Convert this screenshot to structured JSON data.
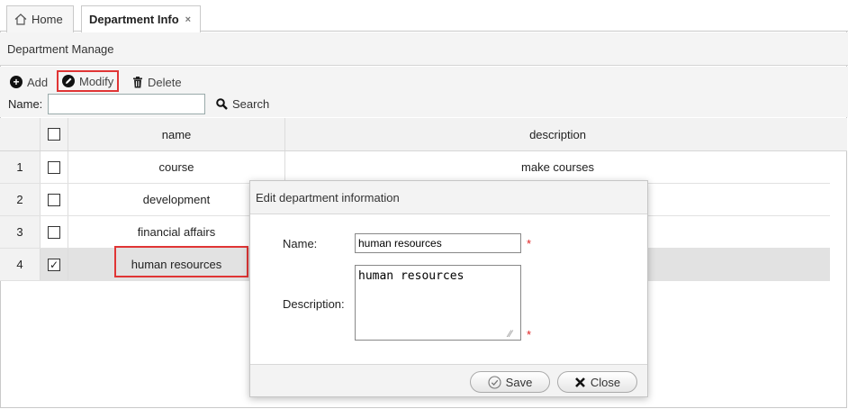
{
  "tabs": [
    {
      "label": "Home",
      "icon": "home-icon"
    },
    {
      "label": "Department Info",
      "close": "×"
    }
  ],
  "panel": {
    "title": "Department Manage"
  },
  "toolbar": {
    "add_label": "Add",
    "modify_label": "Modify",
    "delete_label": "Delete",
    "name_label": "Name:",
    "name_value": "",
    "search_label": "Search"
  },
  "grid": {
    "columns": [
      "name",
      "description"
    ],
    "rows": [
      {
        "num": "1",
        "name": "course",
        "description": "make courses",
        "checked": false
      },
      {
        "num": "2",
        "name": "development",
        "description": "",
        "checked": false
      },
      {
        "num": "3",
        "name": "financial affairs",
        "description": "",
        "checked": false
      },
      {
        "num": "4",
        "name": "human resources",
        "description": "",
        "checked": true
      }
    ]
  },
  "dialog": {
    "title": "Edit department information",
    "name_label": "Name:",
    "name_value": "human resources",
    "description_label": "Description:",
    "description_value": "human resources",
    "required_mark": "*",
    "save_label": "Save",
    "close_label": "Close"
  },
  "colors": {
    "highlight": "#e03535",
    "required": "#e02020"
  }
}
